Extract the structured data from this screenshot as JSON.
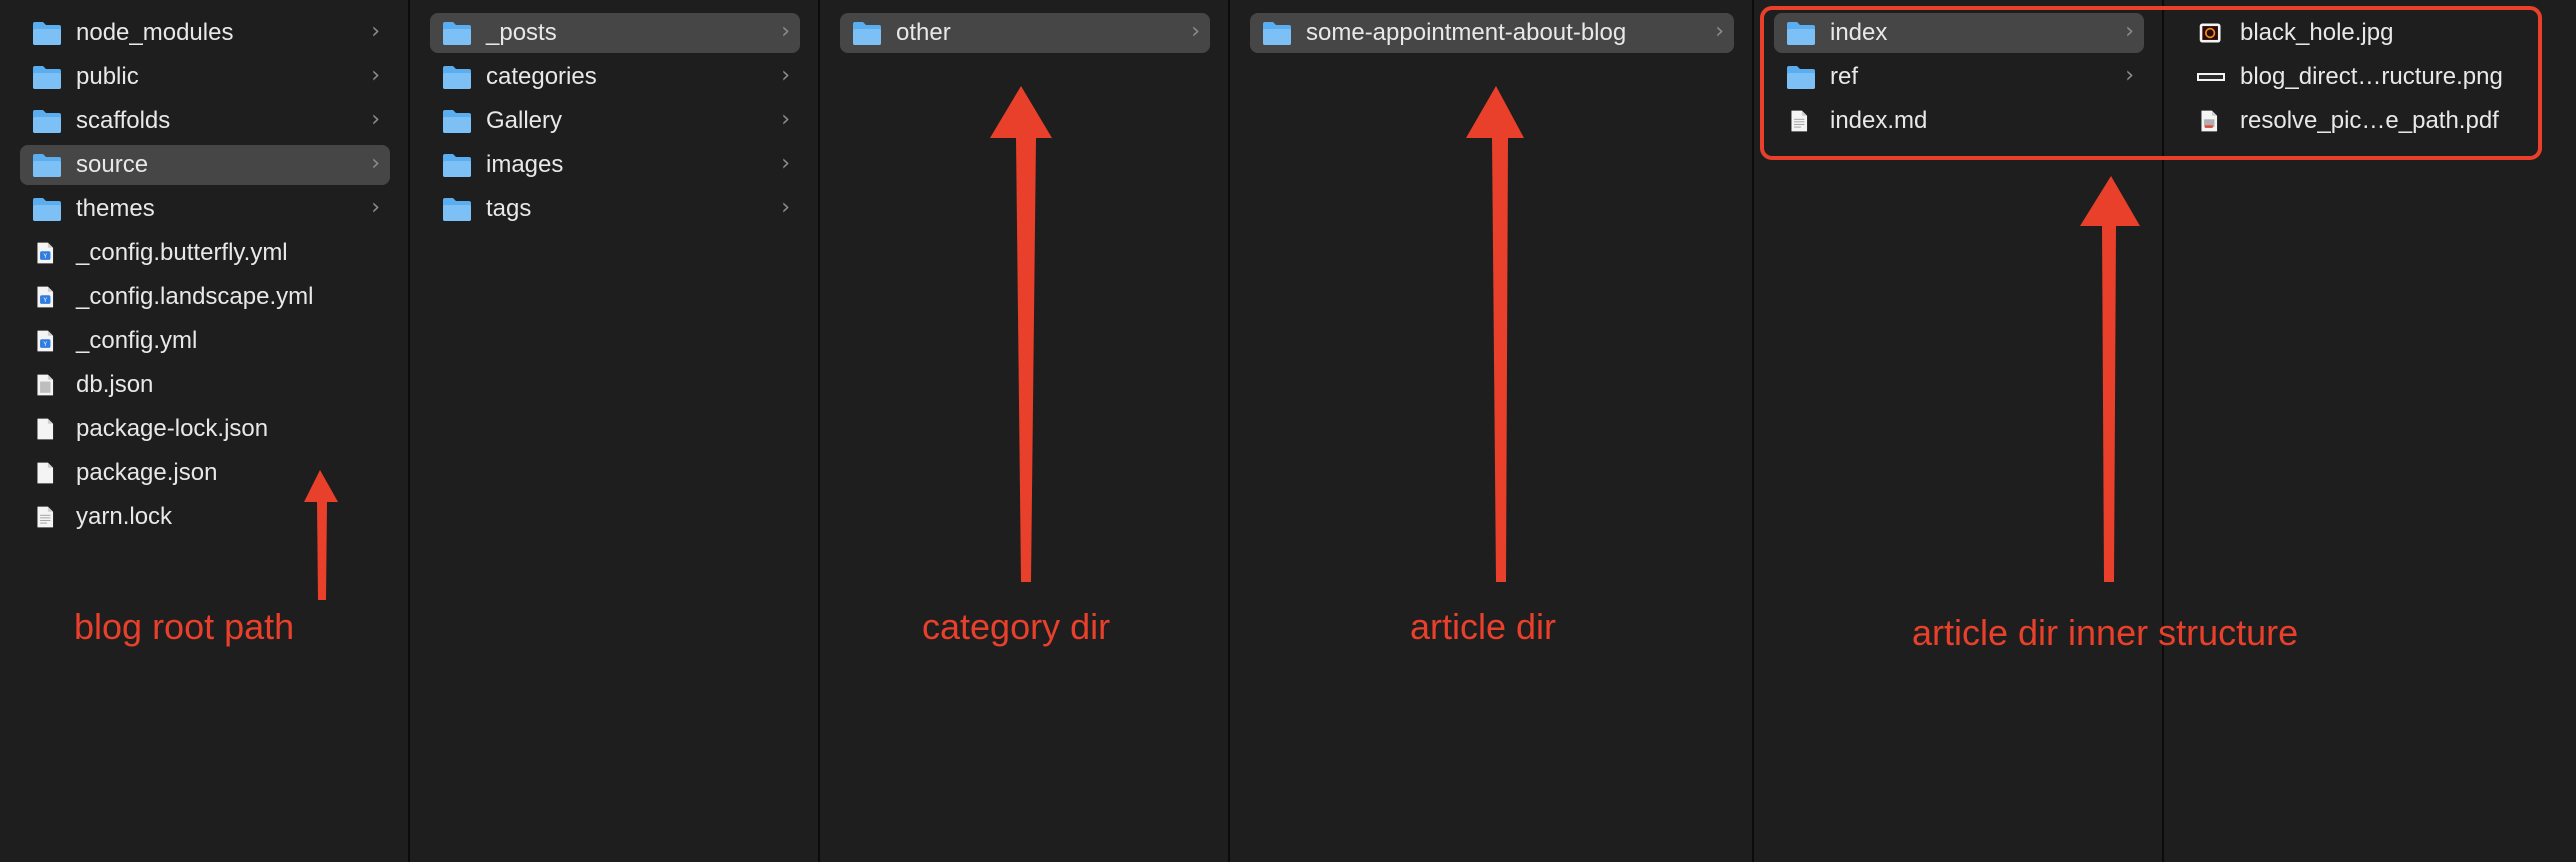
{
  "columns": [
    {
      "items": [
        {
          "name": "node_modules",
          "icon": "folder-icon",
          "chevron": true,
          "selected": false
        },
        {
          "name": "public",
          "icon": "folder-icon",
          "chevron": true,
          "selected": false
        },
        {
          "name": "scaffolds",
          "icon": "folder-icon",
          "chevron": true,
          "selected": false
        },
        {
          "name": "source",
          "icon": "folder-icon",
          "chevron": true,
          "selected": true
        },
        {
          "name": "themes",
          "icon": "folder-icon",
          "chevron": true,
          "selected": false
        },
        {
          "name": "_config.butterfly.yml",
          "icon": "yaml-file-icon",
          "chevron": false,
          "selected": false
        },
        {
          "name": "_config.landscape.yml",
          "icon": "yaml-file-icon",
          "chevron": false,
          "selected": false
        },
        {
          "name": "_config.yml",
          "icon": "yaml-file-icon",
          "chevron": false,
          "selected": false
        },
        {
          "name": "db.json",
          "icon": "json-file-icon",
          "chevron": false,
          "selected": false
        },
        {
          "name": "package-lock.json",
          "icon": "document-file-icon",
          "chevron": false,
          "selected": false
        },
        {
          "name": "package.json",
          "icon": "document-file-icon",
          "chevron": false,
          "selected": false
        },
        {
          "name": "yarn.lock",
          "icon": "text-file-icon",
          "chevron": false,
          "selected": false
        }
      ]
    },
    {
      "items": [
        {
          "name": "_posts",
          "icon": "folder-icon",
          "chevron": true,
          "selected": true
        },
        {
          "name": "categories",
          "icon": "folder-icon",
          "chevron": true,
          "selected": false
        },
        {
          "name": "Gallery",
          "icon": "folder-icon",
          "chevron": true,
          "selected": false
        },
        {
          "name": "images",
          "icon": "folder-icon",
          "chevron": true,
          "selected": false
        },
        {
          "name": "tags",
          "icon": "folder-icon",
          "chevron": true,
          "selected": false
        }
      ]
    },
    {
      "items": [
        {
          "name": "other",
          "icon": "folder-icon",
          "chevron": true,
          "selected": true
        }
      ]
    },
    {
      "items": [
        {
          "name": "some-appointment-about-blog",
          "icon": "folder-icon",
          "chevron": true,
          "selected": true
        }
      ]
    },
    {
      "items": [
        {
          "name": "index",
          "icon": "folder-icon",
          "chevron": true,
          "selected": true
        },
        {
          "name": "ref",
          "icon": "folder-icon",
          "chevron": true,
          "selected": false
        },
        {
          "name": "index.md",
          "icon": "markdown-file-icon",
          "chevron": false,
          "selected": false
        }
      ]
    },
    {
      "items": [
        {
          "name": "black_hole.jpg",
          "icon": "image-file-icon",
          "chevron": false,
          "selected": false
        },
        {
          "name": "blog_direct…ructure.png",
          "icon": "png-file-icon",
          "chevron": false,
          "selected": false
        },
        {
          "name": "resolve_pic…e_path.pdf",
          "icon": "pdf-file-icon",
          "chevron": false,
          "selected": false
        }
      ]
    }
  ],
  "annotations": {
    "root": "blog root path",
    "category": "category dir",
    "article": "article dir",
    "inner": "article dir inner structure",
    "color": "#e8402a"
  },
  "theme": {
    "folder_color": "#5aaef0",
    "selection_color": "#464646",
    "background": "#1e1e1e"
  }
}
